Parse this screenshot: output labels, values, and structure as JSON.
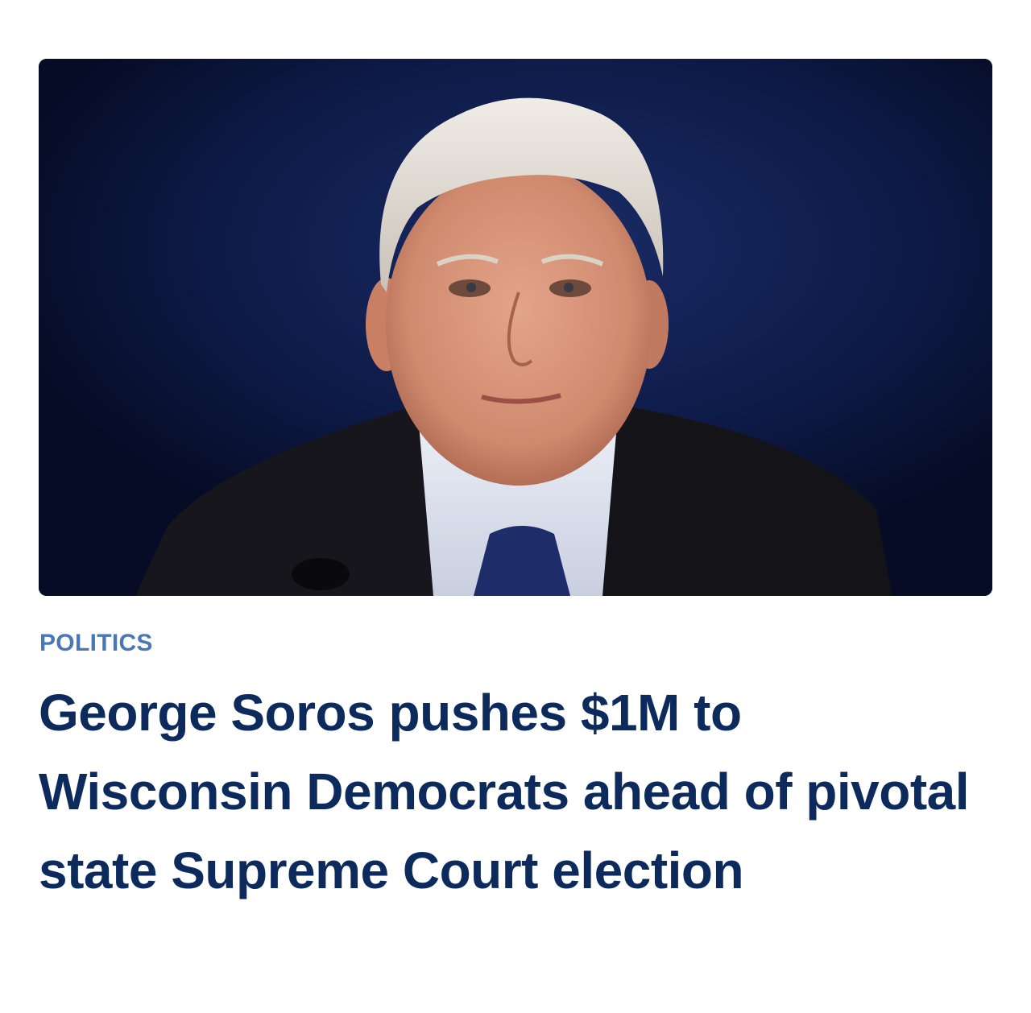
{
  "article": {
    "category": "POLITICS",
    "headline": "George Soros pushes $1M to Wisconsin Democrats ahead of pivotal state Supreme Court election"
  },
  "colors": {
    "category": "#4a78b6",
    "headline": "#0c2a5c",
    "photo_background": "#0d1a44"
  }
}
